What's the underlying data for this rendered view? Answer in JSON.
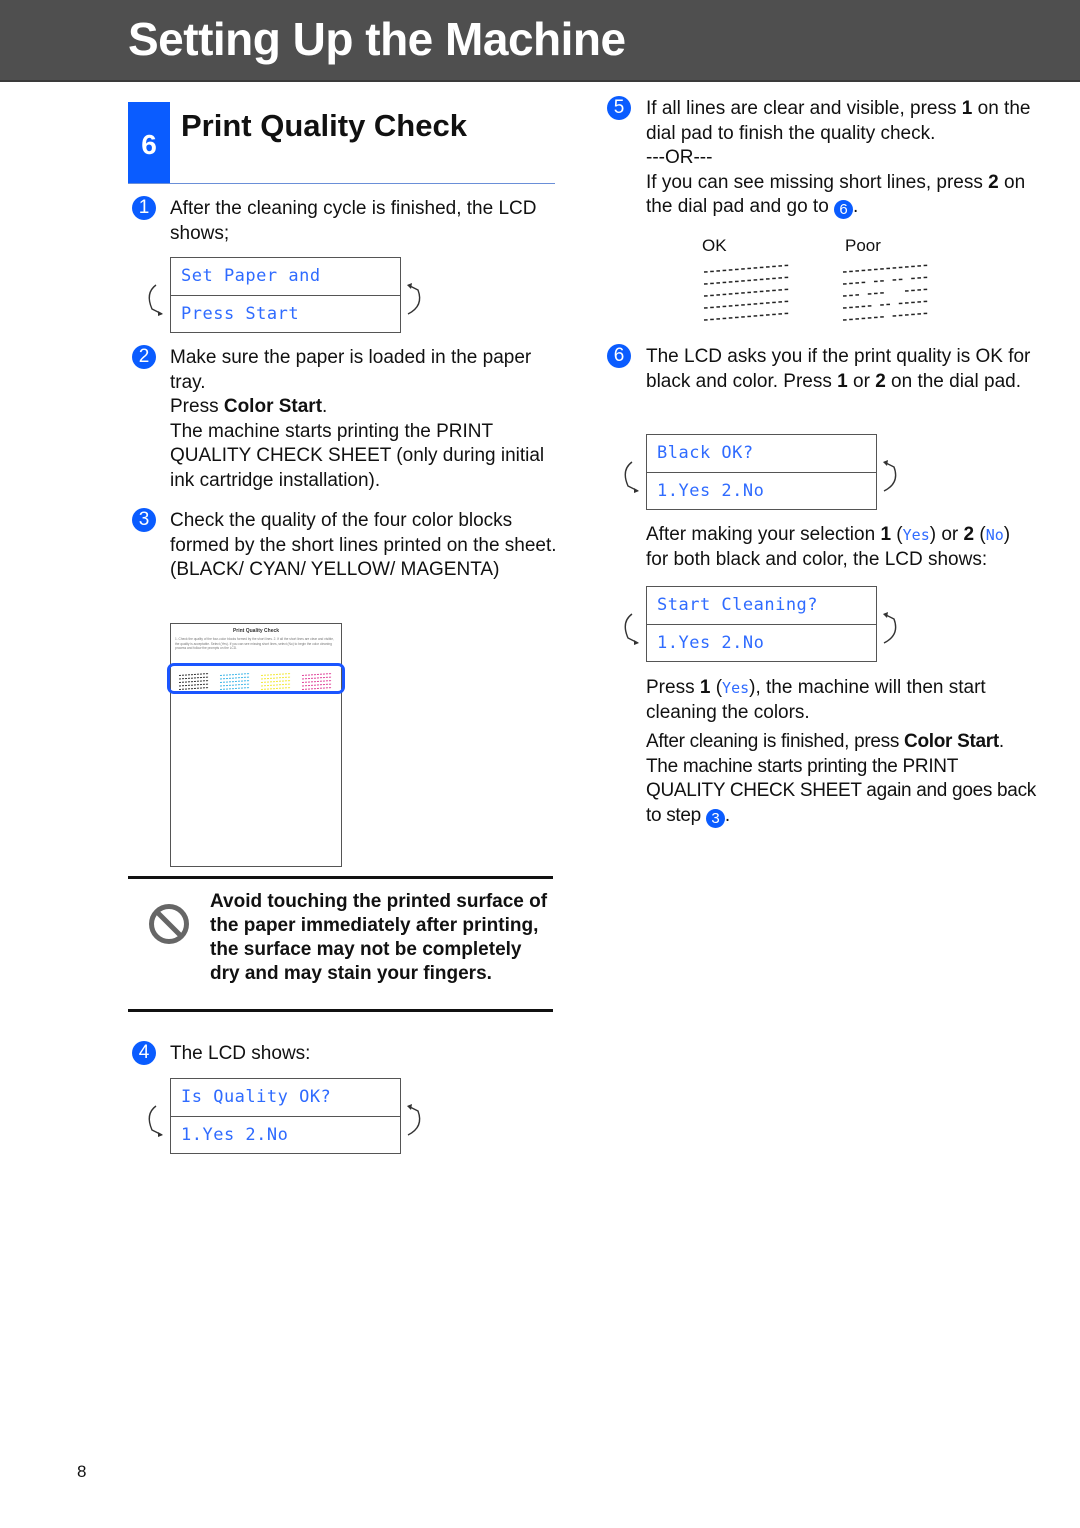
{
  "header": {
    "title": "Setting Up the Machine"
  },
  "section": {
    "number": "6",
    "title": "Print Quality Check"
  },
  "steps": {
    "s1": {
      "num": "1",
      "text": "After the cleaning cycle is finished, the LCD shows;",
      "lcd": [
        "Set Paper and",
        "Press Start"
      ]
    },
    "s2": {
      "num": "2",
      "line1": "Make sure the paper is loaded in the paper tray.",
      "press": "Press ",
      "press_bold": "Color Start",
      "press_end": ".",
      "line3": "The machine starts printing the PRINT QUALITY CHECK SHEET (only during initial ink cartridge installation)."
    },
    "s3": {
      "num": "3",
      "text": "Check the quality of the four color blocks formed by the short lines printed on the sheet.",
      "colors": "(BLACK/ CYAN/ YELLOW/ MAGENTA)"
    },
    "s4": {
      "num": "4",
      "text": "The LCD shows:",
      "lcd": [
        "Is Quality OK?",
        "1.Yes 2.No"
      ]
    },
    "s5": {
      "num": "5",
      "a": "If all lines are clear and visible, press ",
      "a_bold": "1",
      "a_end": " on the dial pad to finish the quality check.",
      "or": "---OR---",
      "b": "If you can see missing short lines, press ",
      "b_bold": "2",
      "b_end": " on the dial pad and go to ",
      "b_ref": "6",
      "b_dot": ".",
      "ok_label": "OK",
      "poor_label": "Poor"
    },
    "s6": {
      "num": "6",
      "a": "The LCD asks you if the print quality is OK for black and color. Press ",
      "a_b1": "1",
      "a_or": " or ",
      "a_b2": "2",
      "a_end": " on the dial pad.",
      "lcd1": [
        "Black OK?",
        "1.Yes 2.No"
      ],
      "b1": "After making your selection ",
      "b_1": "1",
      "b_p1": " (",
      "b_yes": "Yes",
      "b_p2": ") or ",
      "b_2": "2",
      "b_p3": " (",
      "b_no": "No",
      "b_p4": ")",
      "b_end": " for both black and color, the LCD shows:",
      "lcd2": [
        "Start Cleaning?",
        "1.Yes 2.No"
      ],
      "c1": "Press ",
      "c_b": "1",
      "c_p1": " (",
      "c_yes": "Yes",
      "c_end": "), the machine will then start cleaning the colors.",
      "d1": "After cleaning is finished, press ",
      "d_b": "Color Start",
      "d_end": ".",
      "e": "The machine starts printing the PRINT QUALITY CHECK SHEET again and goes back to step ",
      "e_ref": "3",
      "e_dot": "."
    }
  },
  "sheet": {
    "title": "Print Quality Check",
    "text": "1. Check the quality of the four-color blocks formed by the short lines. 2. If all the short lines are clear and visible, the quality is acceptable. Select (Yes). If you can see missing short lines, select (No) to begin the color cleaning process and follow the prompts on the LCD.",
    "block_colors": [
      "#333333",
      "#3fb6e8",
      "#f2e83a",
      "#e0449a"
    ]
  },
  "warning": {
    "text": "Avoid touching the printed surface of the paper immediately after printing, the surface may not be completely dry and may stain your fingers."
  },
  "page_number": "8"
}
